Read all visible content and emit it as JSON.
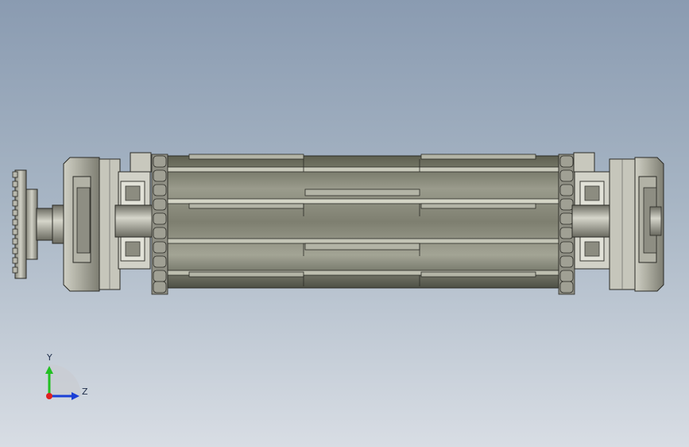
{
  "view": {
    "background_top": "#8a9bb1",
    "background_bottom": "#d8dde4"
  },
  "triad": {
    "y_label": "Y",
    "z_label": "Z",
    "y_color": "#22c022",
    "z_color": "#1a3fd6",
    "x_color": "#e02020"
  },
  "model": {
    "name": "conveyor-roller-assembly",
    "icons": [
      "sprocket-icon",
      "bearing-housing-icon",
      "aluminum-profile-icon",
      "roller-drum-icon",
      "chain-icon"
    ]
  }
}
